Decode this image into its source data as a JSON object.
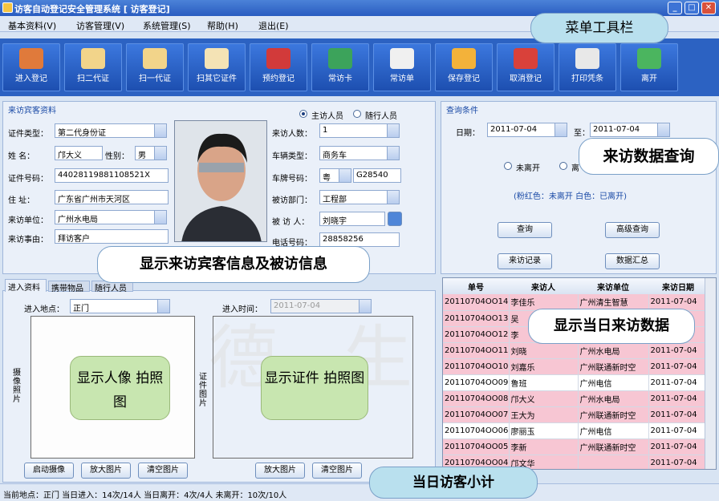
{
  "window": {
    "title": "访客自动登记安全管理系统 [ 访客登记]"
  },
  "menu": [
    "基本资料(V)",
    "访客管理(V)",
    "系统管理(S)",
    "帮助(H)",
    "退出(E)"
  ],
  "toolbar": [
    "进入登记",
    "扫二代证",
    "扫一代证",
    "扫其它证件",
    "预约登记",
    "常访卡",
    "常访单",
    "保存登记",
    "取消登记",
    "打印凭条",
    "离开"
  ],
  "visitor": {
    "group_title": "来访宾客资料",
    "role_main": "主访人员",
    "role_companion": "随行人员",
    "id_type_label": "证件类型：",
    "id_type": "第二代身份证",
    "name_label": "姓    名：",
    "name": "邝大义",
    "gender_label": "性别：",
    "gender": "男",
    "id_no_label": "证件号码：",
    "id_no": "44028119881108521X",
    "address_label": "住    址：",
    "address": "广东省广州市天河区",
    "company_label": "来访单位：",
    "company": "广州水电局",
    "reason_label": "来访事由：",
    "reason": "拜访客户",
    "count_label": "来访人数：",
    "count": "1",
    "vehicle_label": "车辆类型：",
    "vehicle": "商务车",
    "plate_label": "车牌号码：",
    "plate_prefix": "粤",
    "plate": "G28540",
    "dept_label": "被访部门：",
    "dept": "工程部",
    "host_label": "被 访 人：",
    "host": "刘晓宇",
    "phone_label": "电话号码：",
    "phone": "28858256"
  },
  "query": {
    "group_title": "查询条件",
    "date_label": "日期：",
    "date_from": "2011-07-04",
    "to_label": "至：",
    "date_to": "2011-07-04",
    "radio_not_left": "未离开",
    "radio_left": "离",
    "legend": "(粉红色：未离开   白色：已离开)",
    "search": "查询",
    "advanced": "高级查询",
    "records": "来访记录",
    "summary": "数据汇总"
  },
  "tabs": [
    "进入资料",
    "携带物品",
    "随行人员"
  ],
  "entry": {
    "place_label": "进入地点：",
    "place": "正门",
    "time_label": "进入时间：",
    "time": "2011-07-04",
    "cam_side_label": "摄像照片",
    "doc_side_label": "证件图片",
    "start_cam": "启动摄像",
    "zoom1": "放大图片",
    "clear1": "清空图片",
    "zoom2": "放大图片",
    "clear2": "清空图片"
  },
  "grid": {
    "headers": [
      "单号",
      "来访人",
      "来访单位",
      "来访日期"
    ],
    "rows": [
      {
        "no": "20110704OO14",
        "name": "李佳乐",
        "org": "广州清生智慧",
        "date": "2011-07-04",
        "pink": true
      },
      {
        "no": "20110704OO13",
        "name": "吴",
        "org": "",
        "date": "",
        "pink": true
      },
      {
        "no": "20110704OO12",
        "name": "李",
        "org": "",
        "date": "",
        "pink": true
      },
      {
        "no": "20110704OO11",
        "name": "刘晓",
        "org": "广州水电局",
        "date": "2011-07-04",
        "pink": true
      },
      {
        "no": "20110704OO10",
        "name": "刘嘉乐",
        "org": "广州联通新时空",
        "date": "2011-07-04",
        "pink": true
      },
      {
        "no": "20110704OO09",
        "name": "鲁班",
        "org": "广州电信",
        "date": "2011-07-04",
        "pink": false
      },
      {
        "no": "20110704OO08",
        "name": "邝大义",
        "org": "广州水电局",
        "date": "2011-07-04",
        "pink": true
      },
      {
        "no": "20110704OO07",
        "name": "王大为",
        "org": "广州联通新时空",
        "date": "2011-07-04",
        "pink": true
      },
      {
        "no": "20110704OO06",
        "name": "廖丽玉",
        "org": "广州电信",
        "date": "2011-07-04",
        "pink": false
      },
      {
        "no": "20110704OO05",
        "name": "李新",
        "org": "广州联通新时空",
        "date": "2011-07-04",
        "pink": true
      },
      {
        "no": "20110704OO04",
        "name": "邝文华",
        "org": "",
        "date": "2011-07-04",
        "pink": true
      }
    ]
  },
  "status": "当前地点：正门 当日进入：14次/14人   当日离开：4次/4人   未离开：10次/10人",
  "callouts": {
    "menu": "菜单工具栏",
    "query": "来访数据查询",
    "info": "显示来访宾客信息及被访信息",
    "today": "显示当日来访数据",
    "summary": "当日访客小计",
    "portrait": "显示人像 拍照图",
    "doc": "显示证件 拍照图"
  },
  "watermark": "德   生",
  "colors": {
    "toolbar": "#2c62c2",
    "pink_row": "#f7c6d3",
    "callout_green": "#b9e0ee"
  }
}
